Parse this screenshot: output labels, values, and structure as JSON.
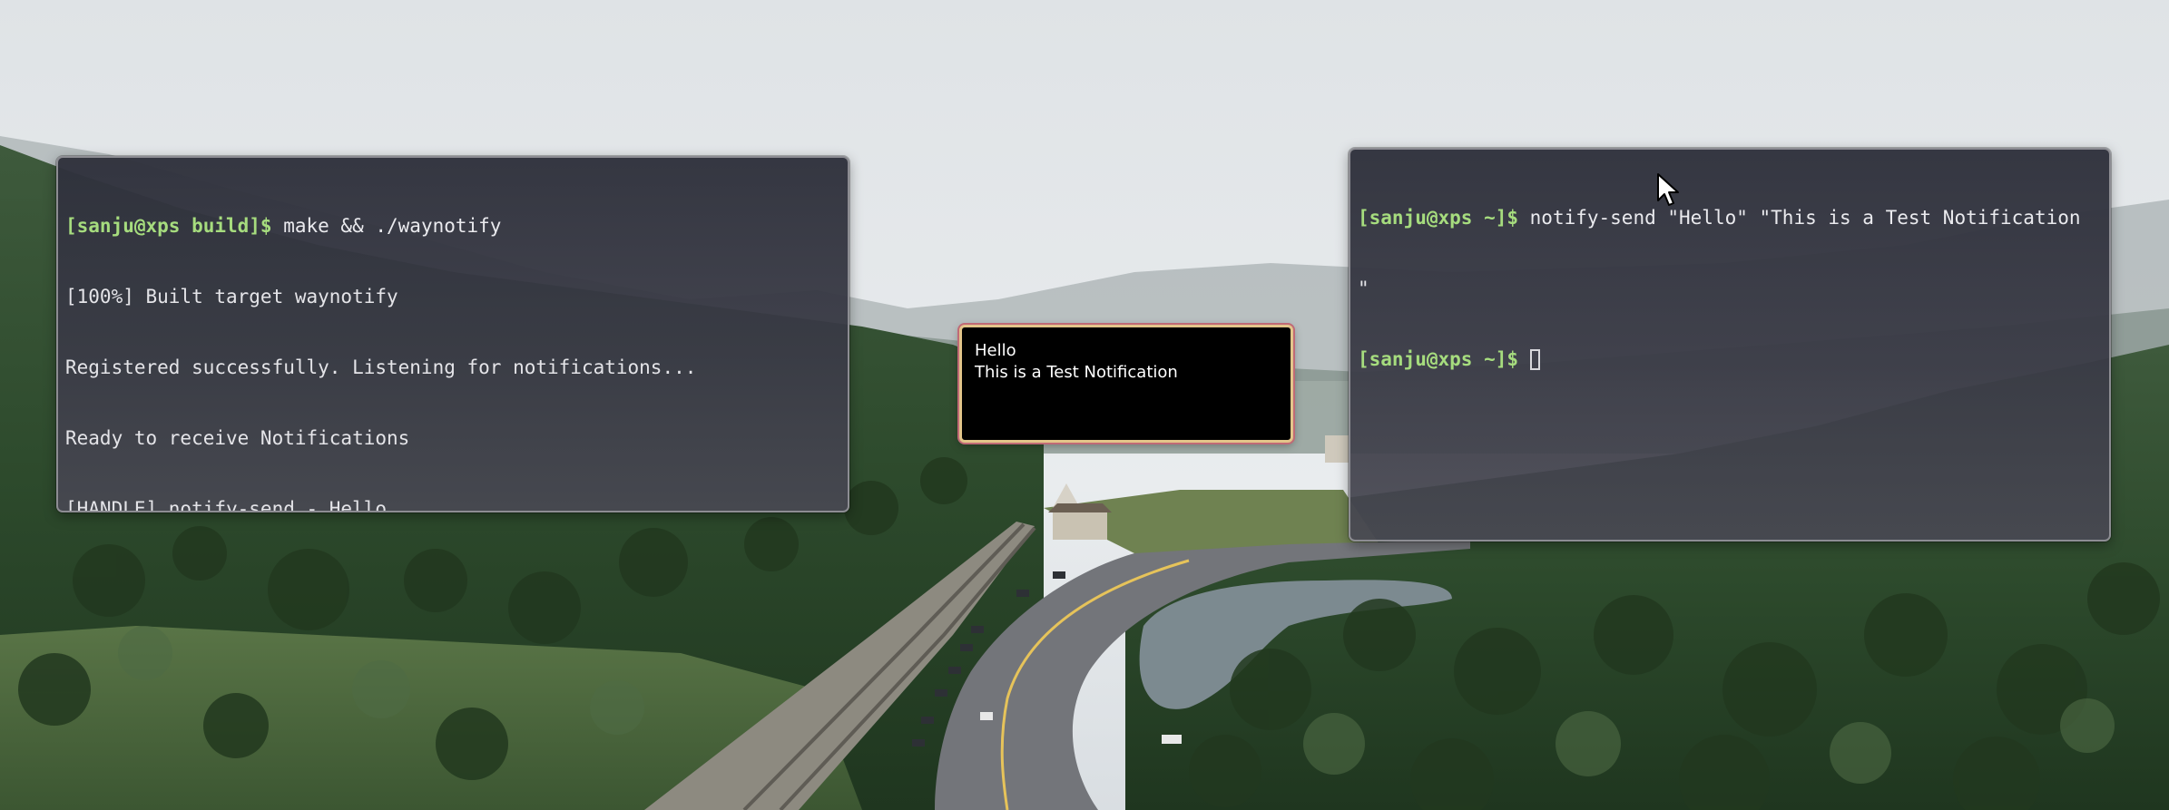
{
  "terminal_left": {
    "lines": [
      {
        "prompt": "[sanju@xps build]$",
        "command": " make && ./waynotify"
      },
      {
        "text": "[100%] Built target waynotify"
      },
      {
        "text": "Registered successfully. Listening for notifications..."
      },
      {
        "text": "Ready to receive Notifications"
      },
      {
        "text": "[HANDLE] notify-send - Hello"
      }
    ]
  },
  "terminal_right": {
    "line1": {
      "prompt": "[sanju@xps ~]$",
      "command": " notify-send \"Hello\" \"This is a Test Notification"
    },
    "continuation": "\"",
    "line3": {
      "prompt": "[sanju@xps ~]$",
      "command": " "
    }
  },
  "notification": {
    "summary": "Hello",
    "body": "This is a Test Notification"
  },
  "colors": {
    "prompt": "#a6dc7e",
    "terminal_text": "#e4e4e8",
    "notification_bg": "#000000",
    "notification_border": "#e3c58a"
  }
}
